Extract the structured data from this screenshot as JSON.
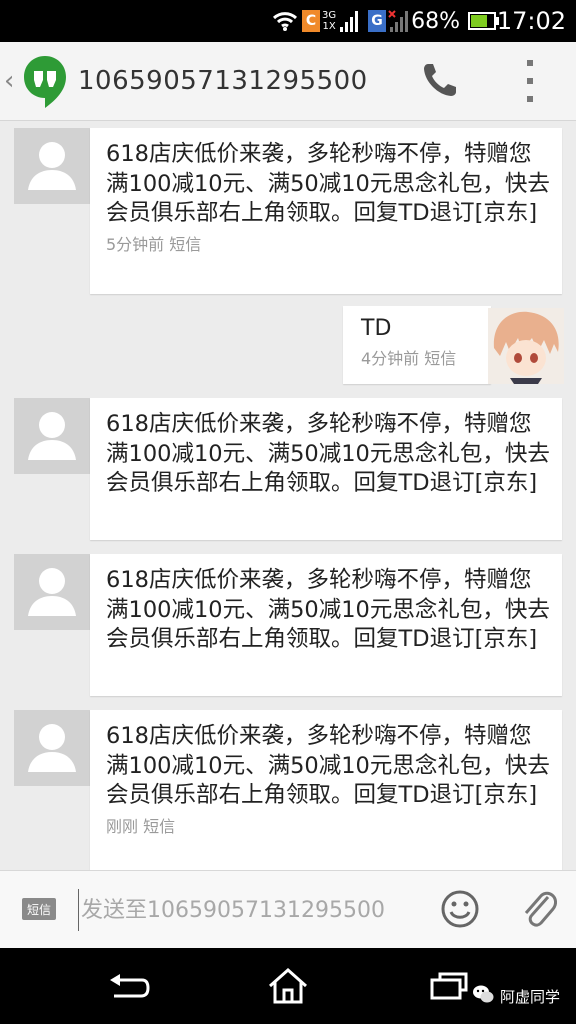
{
  "status_bar": {
    "network_a": "3G",
    "network_b": "1X",
    "carrier_letter_a": "C",
    "carrier_letter_b": "G",
    "battery_percent": "68%",
    "battery_level": 0.68,
    "time": "17:02"
  },
  "header": {
    "contact": "10659057131295500",
    "back_icon": "chevron-left-icon",
    "app_icon": "hangouts-icon",
    "call_icon": "phone-icon",
    "menu_icon": "overflow-menu-icon"
  },
  "messages": [
    {
      "direction": "received",
      "text": "618店庆低价来袭，多轮秒嗨不停，特赠您满100减10元、满50减10元思念礼包，快去会员俱乐部右上角领取。回复TD退订[京东]",
      "meta": "5分钟前 短信"
    },
    {
      "direction": "sent",
      "text": "TD",
      "meta": "4分钟前 短信"
    },
    {
      "direction": "received",
      "text": "618店庆低价来袭，多轮秒嗨不停，特赠您满100减10元、满50减10元思念礼包，快去会员俱乐部右上角领取。回复TD退订[京东]",
      "meta": ""
    },
    {
      "direction": "received",
      "text": "618店庆低价来袭，多轮秒嗨不停，特赠您满100减10元、满50减10元思念礼包，快去会员俱乐部右上角领取。回复TD退订[京东]",
      "meta": ""
    },
    {
      "direction": "received",
      "text": "618店庆低价来袭，多轮秒嗨不停，特赠您满100减10元、满50减10元思念礼包，快去会员俱乐部右上角领取。回复TD退订[京东]",
      "meta": "刚刚 短信"
    }
  ],
  "composer": {
    "sms_badge": "短信",
    "placeholder": "发送至10659057131295500",
    "emoji_icon": "smiley-icon",
    "attach_icon": "paperclip-icon"
  },
  "nav": {
    "back_icon": "back-arrow-icon",
    "home_icon": "home-icon",
    "recents_icon": "recent-apps-icon"
  },
  "watermark": {
    "text": "阿虚同学",
    "icon": "wechat-icon"
  },
  "colors": {
    "app_green": "#2e9b36",
    "background": "#ececec",
    "battery_green": "#7ecb20"
  }
}
